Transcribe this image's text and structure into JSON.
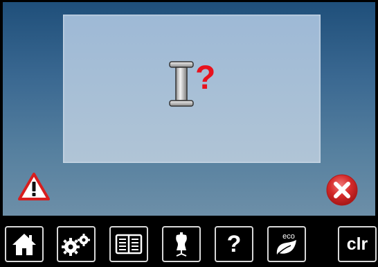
{
  "dialog": {
    "icon": "bobbin-spool-question-icon",
    "question_mark": "?"
  },
  "status": {
    "warning_icon": "warning-triangle-icon",
    "close_icon": "close-x-icon"
  },
  "toolbar": {
    "items": [
      {
        "icon": "home-icon"
      },
      {
        "icon": "settings-gears-icon"
      },
      {
        "icon": "tutorial-book-icon"
      },
      {
        "icon": "dress-form-icon"
      },
      {
        "icon": "help-icon",
        "label": "?"
      },
      {
        "icon": "eco-leaf-icon",
        "label": "eco"
      },
      {
        "icon": "clear-icon",
        "label": "clr"
      }
    ]
  },
  "colors": {
    "screen_top": "#1f4f7a",
    "screen_bottom": "#6d8fa8",
    "dialog_bg": "#a7bfd6",
    "question_red": "#e8121d",
    "close_red": "#d42a2a",
    "warning_red": "#d81e1e",
    "toolbar_bg": "#000000",
    "button_border": "#d8d8d8"
  }
}
